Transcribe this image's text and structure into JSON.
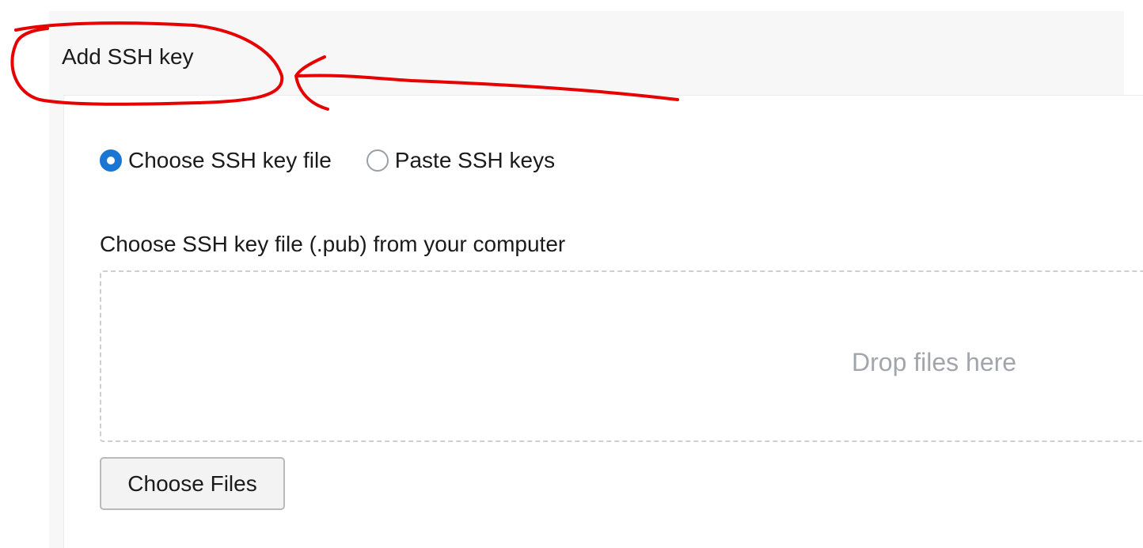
{
  "panel": {
    "title": "Add SSH key"
  },
  "key_source": {
    "options": [
      {
        "label": "Choose SSH key file",
        "selected": true
      },
      {
        "label": "Paste SSH keys",
        "selected": false
      }
    ]
  },
  "file_upload": {
    "label": "Choose SSH key file (.pub) from your computer",
    "drop_text": "Drop files here",
    "button_label": "Choose Files"
  },
  "colors": {
    "accent": "#1976d2",
    "annotation": "#e60000",
    "header_background": "#f7f7f7",
    "placeholder_text": "#a2a6ab"
  }
}
